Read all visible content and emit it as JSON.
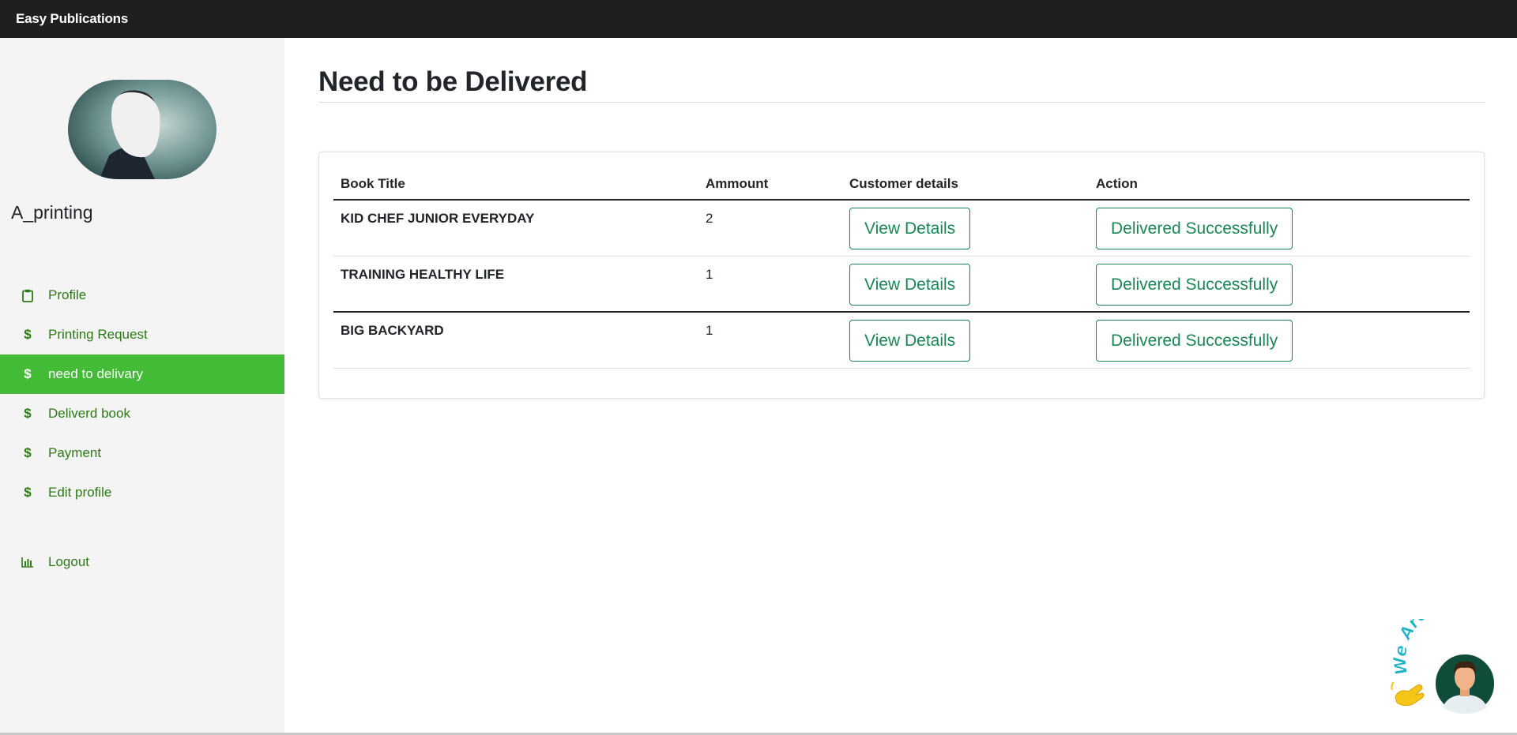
{
  "app": {
    "brand": "Easy Publications"
  },
  "sidebar": {
    "username": "A_printing",
    "items": [
      {
        "label": "Profile",
        "icon": "clipboard-icon",
        "active": false
      },
      {
        "label": "Printing Request",
        "icon": "dollar-icon",
        "active": false
      },
      {
        "label": "need to delivary",
        "icon": "dollar-icon",
        "active": true
      },
      {
        "label": "Deliverd book",
        "icon": "dollar-icon",
        "active": false
      },
      {
        "label": "Payment",
        "icon": "dollar-icon",
        "active": false
      },
      {
        "label": "Edit profile",
        "icon": "dollar-icon",
        "active": false
      }
    ],
    "logout": {
      "label": "Logout",
      "icon": "bar-chart-icon"
    }
  },
  "main": {
    "title": "Need to be Delivered",
    "table": {
      "headers": [
        "Book Title",
        "Ammount",
        "Customer details",
        "Action"
      ],
      "rows": [
        {
          "book": "KID CHEF JUNIOR EVERYDAY",
          "amount": "2",
          "details_label": "View Details",
          "action_label": "Delivered Successfully"
        },
        {
          "book": "TRAINING HEALTHY LIFE",
          "amount": "1",
          "details_label": "View Details",
          "action_label": "Delivered Successfully"
        },
        {
          "book": "BIG BACKYARD",
          "amount": "1",
          "details_label": "View Details",
          "action_label": "Delivered Successfully"
        }
      ]
    }
  },
  "chat_widget": {
    "text": "We Are Here!",
    "icon": "waving-hand-icon"
  },
  "colors": {
    "topbar": "#1e1f20",
    "sidebar_bg": "#f4f4f4",
    "active": "#43bb36",
    "nav_text": "#2c7a14",
    "button": "#198754"
  }
}
